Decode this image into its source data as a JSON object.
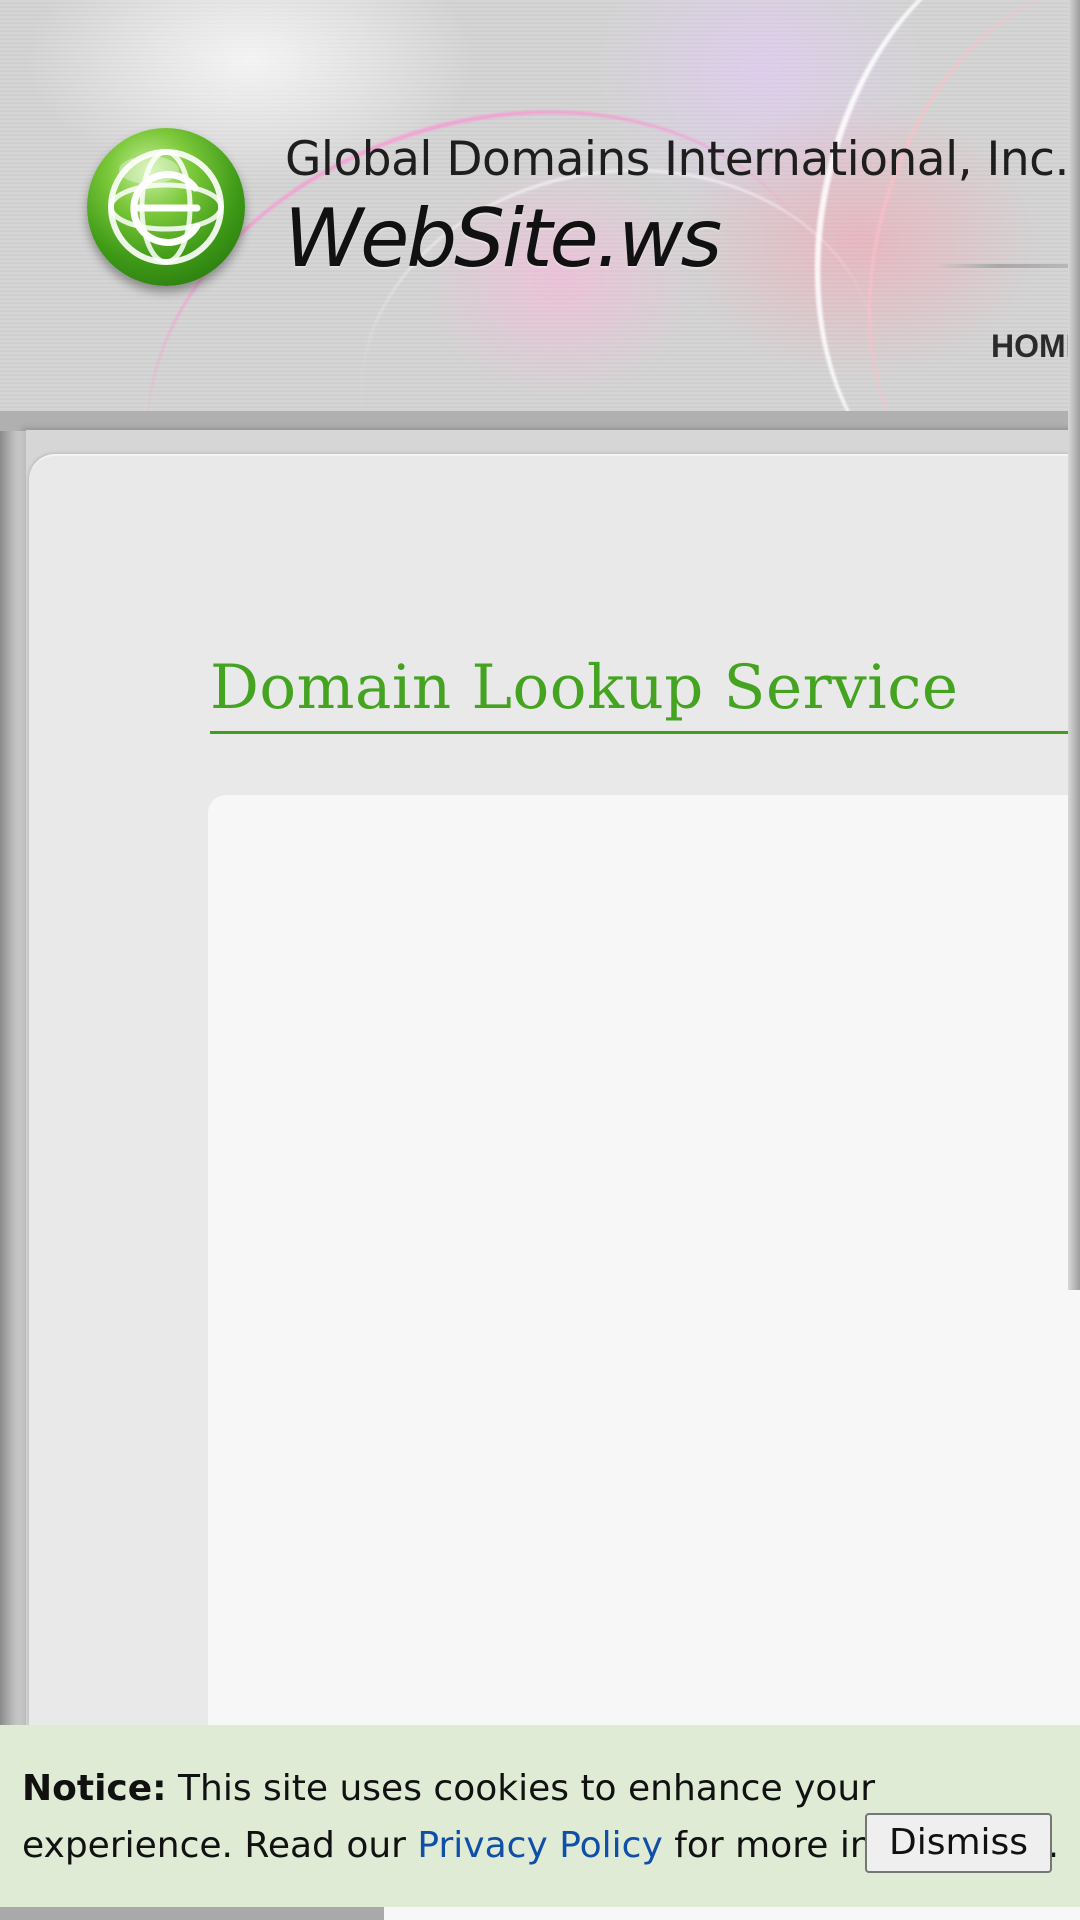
{
  "header": {
    "company_name": "Global Domains International, Inc.",
    "site_name": "WebSite.ws",
    "logo_icon": "globe-e-logo-icon",
    "nav": {
      "home_label": "HOME"
    }
  },
  "main": {
    "page_title": "Domain Lookup Service"
  },
  "cookie_notice": {
    "label": "Notice:",
    "text_before_link": " This site uses cookies to enhance your experience. Read our ",
    "link_label": "Privacy Policy",
    "text_after_link": " for more information.",
    "dismiss_label": "Dismiss"
  },
  "colors": {
    "title_green": "#44a320",
    "link_blue": "#0f4fa8",
    "notice_background": "#dfebd4"
  }
}
